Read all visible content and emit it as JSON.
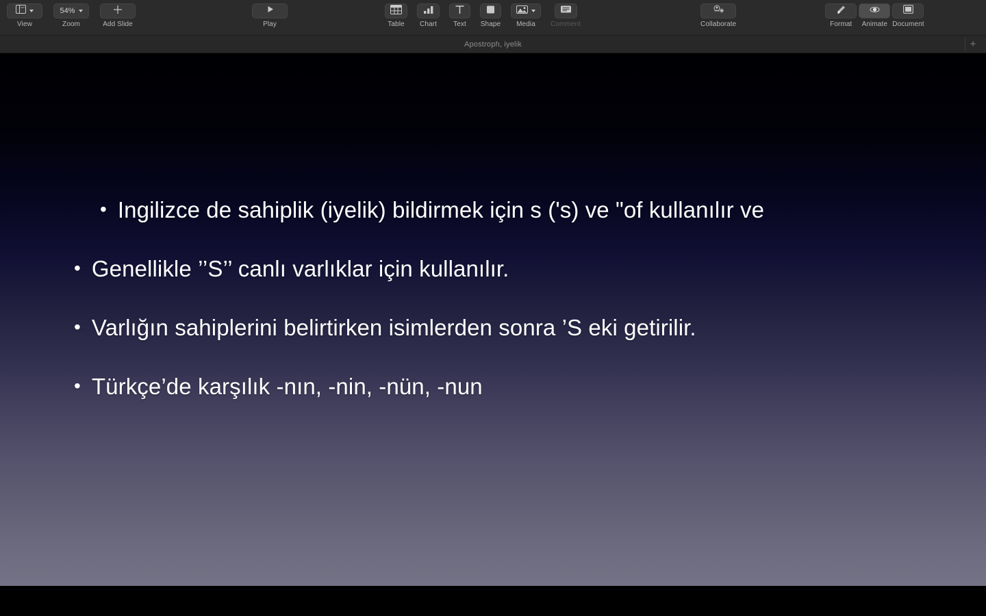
{
  "app": {
    "document_title": "Apostroph, iyelik"
  },
  "toolbar": {
    "left": [
      {
        "label": "View",
        "icon": "sidebar-layout-icon",
        "has_chevron": true,
        "value": ""
      },
      {
        "label": "Zoom",
        "icon": "zoom-icon",
        "has_chevron": true,
        "value": "54%"
      },
      {
        "label": "Add Slide",
        "icon": "plus-icon",
        "has_chevron": false,
        "value": ""
      }
    ],
    "play": {
      "label": "Play",
      "icon": "play-triangle-icon"
    },
    "insert": [
      {
        "label": "Table",
        "icon": "table-grid-icon",
        "has_chevron": false,
        "dim": false
      },
      {
        "label": "Chart",
        "icon": "bar-chart-icon",
        "has_chevron": false,
        "dim": false
      },
      {
        "label": "Text",
        "icon": "text-t-icon",
        "has_chevron": false,
        "dim": false
      },
      {
        "label": "Shape",
        "icon": "square-shape-icon",
        "has_chevron": false,
        "dim": false
      },
      {
        "label": "Media",
        "icon": "photo-icon",
        "has_chevron": true,
        "dim": false
      },
      {
        "label": "Comment",
        "icon": "comment-icon",
        "has_chevron": false,
        "dim": true
      }
    ],
    "collaborate": {
      "label": "Collaborate",
      "icon": "person-add-icon"
    },
    "right": [
      {
        "label": "Format",
        "icon": "paintbrush-icon",
        "active": false
      },
      {
        "label": "Animate",
        "icon": "animate-dot-icon",
        "active": true
      },
      {
        "label": "Document",
        "icon": "document-icon",
        "active": false
      }
    ]
  },
  "tabbar": {
    "new_tab_label": "+"
  },
  "slide": {
    "bullet_glyph": "•",
    "bullets": [
      {
        "text": "Ingilizce de sahiplik (iyelik) bildirmek için s ('s) ve \"of kullanılır ve",
        "indent": true
      },
      {
        "text": "Genellikle ’’S’’ canlı varlıklar için kullanılır.",
        "indent": false
      },
      {
        "text": "Varlığın sahiplerini belirtirken isimlerden sonra ’S eki getirilir.",
        "indent": false
      },
      {
        "text": " Türkçe’de karşılık -nın, -nin, -nün, -nun",
        "indent": false
      }
    ]
  },
  "colors": {
    "toolbar_bg": "#2b2b2b",
    "tabbar_bg": "#282828",
    "slide_top": "#000003",
    "slide_bottom": "#747285",
    "text": "#ffffff"
  }
}
